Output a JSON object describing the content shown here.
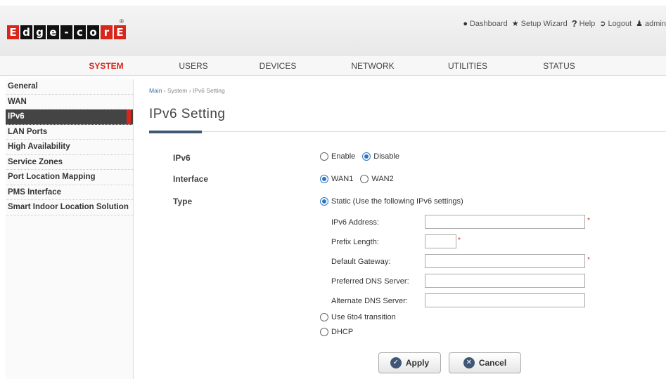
{
  "header": {
    "logo_letters": [
      "E",
      "d",
      "g",
      "e",
      "-",
      "c",
      "o",
      "r",
      "E"
    ],
    "logo_reg": "®",
    "links": {
      "dashboard": "Dashboard",
      "setup_wizard": "Setup Wizard",
      "help": "Help",
      "logout": "Logout",
      "admin": "admin"
    }
  },
  "nav": {
    "items": [
      "SYSTEM",
      "USERS",
      "DEVICES",
      "NETWORK",
      "UTILITIES",
      "STATUS"
    ],
    "active": "SYSTEM"
  },
  "sidebar": {
    "items": [
      "General",
      "WAN",
      "IPv6",
      "LAN Ports",
      "High Availability",
      "Service Zones",
      "Port Location Mapping",
      "PMS Interface",
      "Smart Indoor Location Solution"
    ],
    "active": "IPv6"
  },
  "breadcrumb": {
    "main": "Main",
    "sep1": " › ",
    "system": "System",
    "sep2": " › ",
    "current": "IPv6 Setting"
  },
  "page_title": "IPv6 Setting",
  "form": {
    "ipv6": {
      "label": "IPv6",
      "enable": "Enable",
      "disable": "Disable",
      "selected": "Disable"
    },
    "interface": {
      "label": "Interface",
      "wan1": "WAN1",
      "wan2": "WAN2",
      "selected": "WAN1"
    },
    "type": {
      "label": "Type",
      "static": "Static (Use the following IPv6 settings)",
      "sixto4": "Use 6to4 transition",
      "dhcp": "DHCP",
      "selected": "static"
    },
    "fields": {
      "ipv6_address": {
        "label": "IPv6 Address:",
        "value": ""
      },
      "prefix_length": {
        "label": "Prefix Length:",
        "value": ""
      },
      "default_gateway": {
        "label": "Default Gateway:",
        "value": ""
      },
      "preferred_dns": {
        "label": "Preferred DNS Server:",
        "value": ""
      },
      "alternate_dns": {
        "label": "Alternate DNS Server:",
        "value": ""
      }
    },
    "required_mark": "*"
  },
  "buttons": {
    "apply": "Apply",
    "cancel": "Cancel"
  },
  "colors": {
    "accent_red": "#d9261c",
    "radio_blue": "#2a76c6",
    "title_accent": "#3f5675"
  }
}
